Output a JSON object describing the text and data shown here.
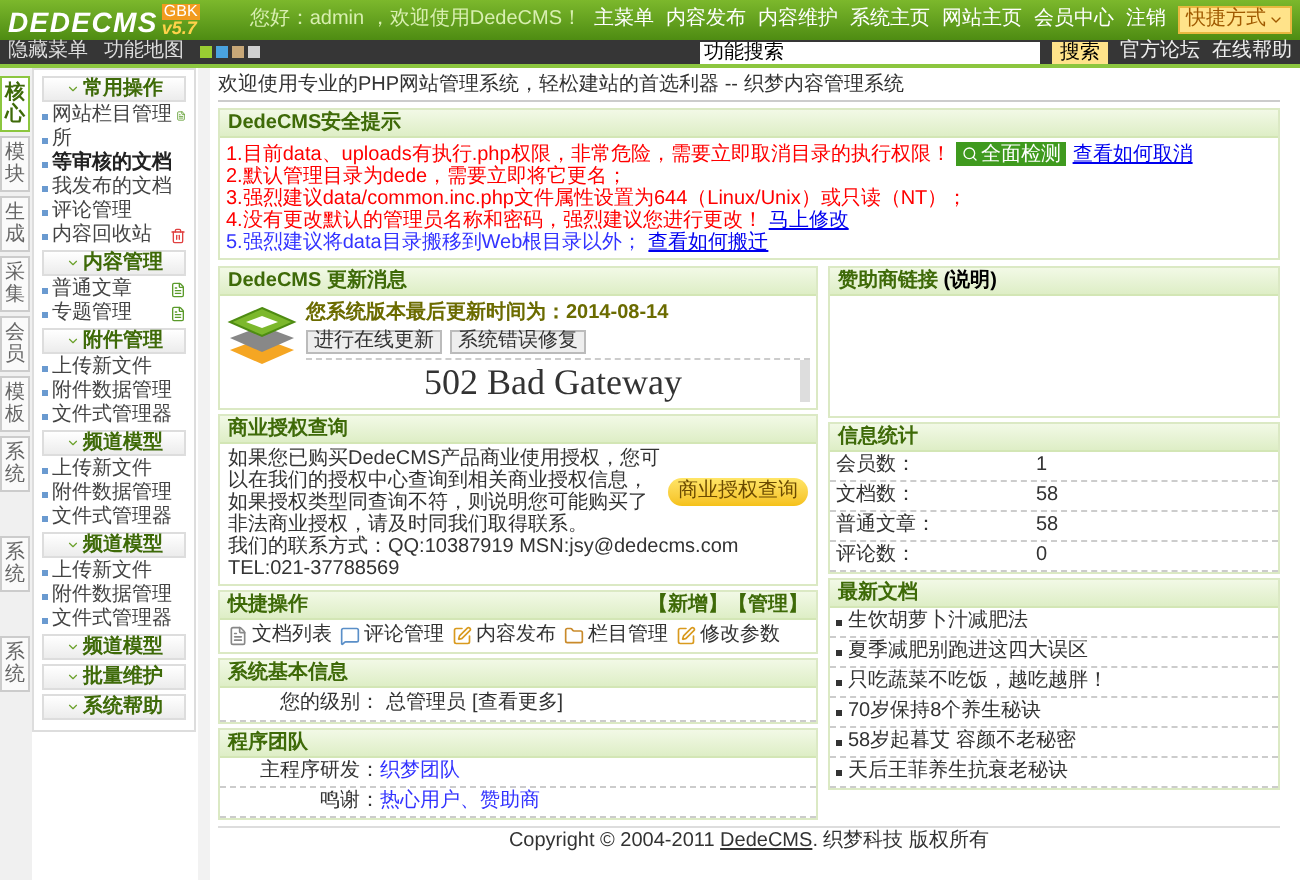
{
  "header": {
    "logo": "DEDECMS",
    "version": "v5.7",
    "edition": "GBK",
    "greeting": "您好：admin ，欢迎使用DedeCMS！",
    "nav": [
      "主菜单",
      "内容发布",
      "内容维护",
      "系统主页",
      "网站主页",
      "会员中心",
      "注销"
    ],
    "shortcut": "快捷方式"
  },
  "toolbar": {
    "hide_menu": "隐藏菜单",
    "function_map": "功能地图",
    "search": {
      "value": "功能搜索"
    },
    "search_button": "搜索",
    "links": [
      "官方论坛",
      "在线帮助"
    ]
  },
  "side_tabs": [
    {
      "label": "核心",
      "selected": true
    },
    {
      "label": "模块",
      "selected": false
    },
    {
      "label": "生成",
      "selected": false
    },
    {
      "label": "采集",
      "selected": false
    },
    {
      "label": "会员",
      "selected": false
    },
    {
      "label": "模板",
      "selected": false
    },
    {
      "label": "系统",
      "selected": false
    },
    {
      "label": "系统",
      "selected": false
    },
    {
      "label": "系统",
      "selected": false
    }
  ],
  "menu": [
    {
      "title": "常用操作",
      "items": [
        {
          "label": "网站栏目管理",
          "kind": "doc"
        },
        {
          "label": "所",
          "kind": "plain"
        },
        {
          "label": "等审核的文档",
          "kind": "bold"
        },
        {
          "label": "我发布的文档",
          "kind": "plain"
        },
        {
          "label": "评论管理",
          "kind": "plain"
        },
        {
          "label": "内容回收站",
          "kind": "trash"
        }
      ]
    },
    {
      "title": "内容管理",
      "items": [
        {
          "label": "普通文章",
          "kind": "doc"
        },
        {
          "label": "专题管理",
          "kind": "doc"
        }
      ]
    },
    {
      "title": "附件管理",
      "items": [
        {
          "label": "上传新文件",
          "kind": "plain"
        },
        {
          "label": "附件数据管理",
          "kind": "plain"
        },
        {
          "label": "文件式管理器",
          "kind": "plain"
        }
      ]
    },
    {
      "title": "频道模型",
      "items": [
        {
          "label": "上传新文件",
          "kind": "plain"
        },
        {
          "label": "附件数据管理",
          "kind": "plain"
        },
        {
          "label": "文件式管理器",
          "kind": "plain"
        }
      ]
    },
    {
      "title": "频道模型",
      "items": [
        {
          "label": "上传新文件",
          "kind": "plain"
        },
        {
          "label": "附件数据管理",
          "kind": "plain"
        },
        {
          "label": "文件式管理器",
          "kind": "plain"
        }
      ]
    },
    {
      "title": "频道模型"
    },
    {
      "title": "批量维护"
    },
    {
      "title": "系统帮助"
    }
  ],
  "welcome": "欢迎使用专业的PHP网站管理系统，轻松建站的首选利器 -- 织梦内容管理系统",
  "security": {
    "title": "DedeCMS安全提示",
    "lines": [
      {
        "text": "1.目前data、uploads有执行.php权限，非常危险，需要立即取消目录的执行权限！",
        "color": "#ff0000",
        "button": "全面检测",
        "link": "查看如何取消"
      },
      {
        "text": "2.默认管理目录为dede，需要立即将它更名；",
        "color": "#ff0000"
      },
      {
        "text": "3.强烈建议data/common.inc.php文件属性设置为644（Linux/Unix）或只读（NT）；",
        "color": "#ff0000"
      },
      {
        "text": "4.没有更改默认的管理员名称和密码，强烈建议您进行更改！",
        "color": "#ff0000",
        "link": "马上修改"
      },
      {
        "text": "5.强烈建议将data目录搬移到Web根目录以外；",
        "color": "#3333ff",
        "link": "查看如何搬迁"
      }
    ]
  },
  "update": {
    "title": "DedeCMS 更新消息",
    "date_line": "您系统版本最后更新时间为：2014-08-14",
    "buttons": [
      "进行在线更新",
      "系统错误修复"
    ],
    "frame_text": "502 Bad Gateway"
  },
  "license": {
    "title": "商业授权查询",
    "text": "如果您已购买DedeCMS产品商业使用授权，您可以在我们的授权中心查询到相关商业授权信息，如果授权类型同查询不符，则说明您可能购买了非法商业授权，请及时同我们取得联系。",
    "contact": "我们的联系方式：QQ:10387919 MSN:jsy@dedecms.com TEL:021-37788569",
    "button": "商业授权查询"
  },
  "quick": {
    "title": "快捷操作",
    "actions": [
      "【新增】",
      "【管理】"
    ],
    "items": [
      {
        "label": "文档列表",
        "kind": "doc"
      },
      {
        "label": "评论管理",
        "kind": "comment"
      },
      {
        "label": "内容发布",
        "kind": "edit"
      },
      {
        "label": "栏目管理",
        "kind": "folder"
      },
      {
        "label": "修改参数",
        "kind": "edit"
      }
    ]
  },
  "sysinfo": {
    "title": "系统基本信息",
    "label": "您的级别：",
    "value": "总管理员",
    "more": "[查看更多]"
  },
  "team": {
    "title": "程序团队",
    "rows": [
      {
        "label": "主程序研发：",
        "links": [
          "织梦团队"
        ]
      },
      {
        "label": "鸣谢：",
        "links": [
          "热心用户、赞助商"
        ]
      }
    ]
  },
  "sponsor": {
    "title": "赞助商链接",
    "note": "(说明)"
  },
  "stats": {
    "title": "信息统计",
    "rows": [
      {
        "label": "会员数：",
        "value": "1"
      },
      {
        "label": "文档数：",
        "value": "58"
      },
      {
        "label": "普通文章：",
        "value": "58"
      },
      {
        "label": "评论数：",
        "value": "0"
      }
    ]
  },
  "latest": {
    "title": "最新文档",
    "items": [
      "生饮胡萝卜汁减肥法",
      "夏季减肥别跑进这四大误区",
      "只吃蔬菜不吃饭，越吃越胖！",
      "70岁保持8个养生秘诀",
      "58岁起暮艾 容颜不老秘密",
      "天后王菲养生抗衰老秘诀"
    ]
  },
  "footer": {
    "prefix": "Copyright © 2004-2011",
    "link": "DedeCMS",
    "suffix": ". 织梦科技 版权所有"
  }
}
